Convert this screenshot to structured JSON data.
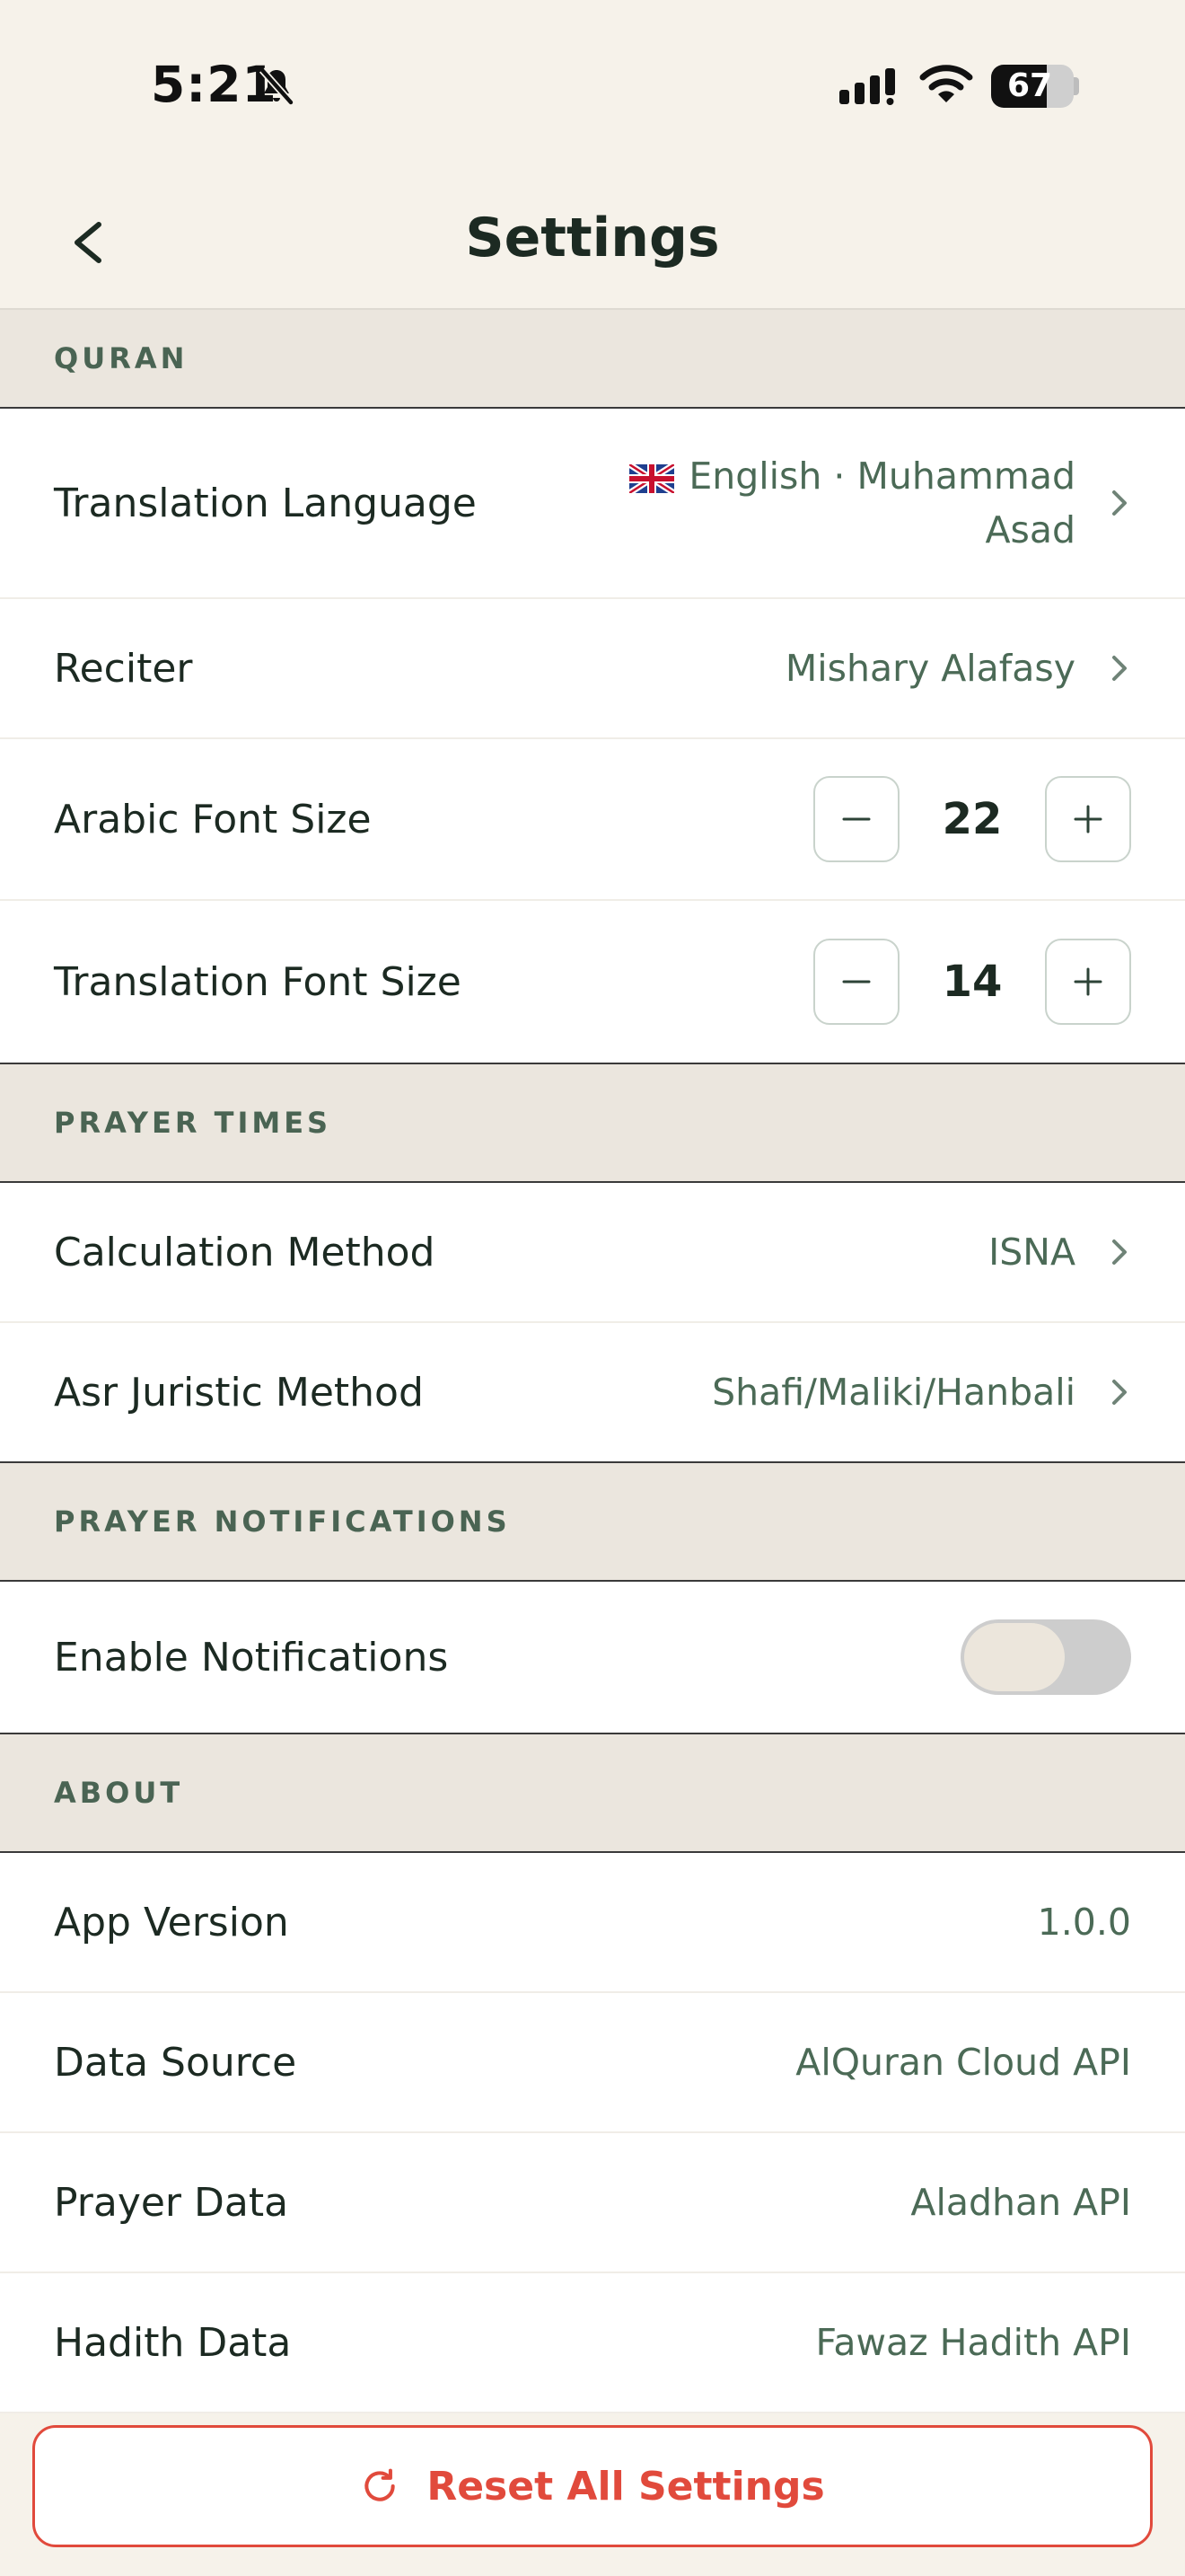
{
  "status_bar": {
    "time": "5:21",
    "battery": "67",
    "battery_level": 0.67,
    "icons": [
      "bell-slash-icon",
      "signal-icon",
      "wifi-icon",
      "battery-icon"
    ]
  },
  "header": {
    "title": "Settings",
    "back_icon": "chevron-left-icon"
  },
  "sections": {
    "quran": {
      "title": "QURAN",
      "translation_language": {
        "label": "Translation Language",
        "value_line1": "English · Muhammad",
        "value_line2": "Asad",
        "flag_icon": "uk-flag-icon"
      },
      "reciter": {
        "label": "Reciter",
        "value": "Mishary Alafasy"
      },
      "arabic_font_size": {
        "label": "Arabic Font Size",
        "value": "22"
      },
      "translation_font_size": {
        "label": "Translation Font Size",
        "value": "14"
      }
    },
    "prayer_times": {
      "title": "PRAYER TIMES",
      "calculation_method": {
        "label": "Calculation Method",
        "value": "ISNA"
      },
      "asr_method": {
        "label": "Asr Juristic Method",
        "value": "Shafi/Maliki/Hanbali"
      }
    },
    "prayer_notifications": {
      "title": "PRAYER NOTIFICATIONS",
      "enable": {
        "label": "Enable Notifications",
        "enabled": false
      }
    },
    "about": {
      "title": "ABOUT",
      "app_version": {
        "label": "App Version",
        "value": "1.0.0"
      },
      "data_source": {
        "label": "Data Source",
        "value": "AlQuran Cloud API"
      },
      "prayer_data": {
        "label": "Prayer Data",
        "value": "Aladhan API"
      },
      "hadith_data": {
        "label": "Hadith Data",
        "value": "Fawaz Hadith API"
      }
    }
  },
  "reset": {
    "label": "Reset All Settings",
    "icon": "refresh-icon"
  },
  "colors": {
    "background": "#f6f2ea",
    "section_header": "#ebe6de",
    "value_text": "#4b6a56",
    "danger": "#e14a3c"
  }
}
